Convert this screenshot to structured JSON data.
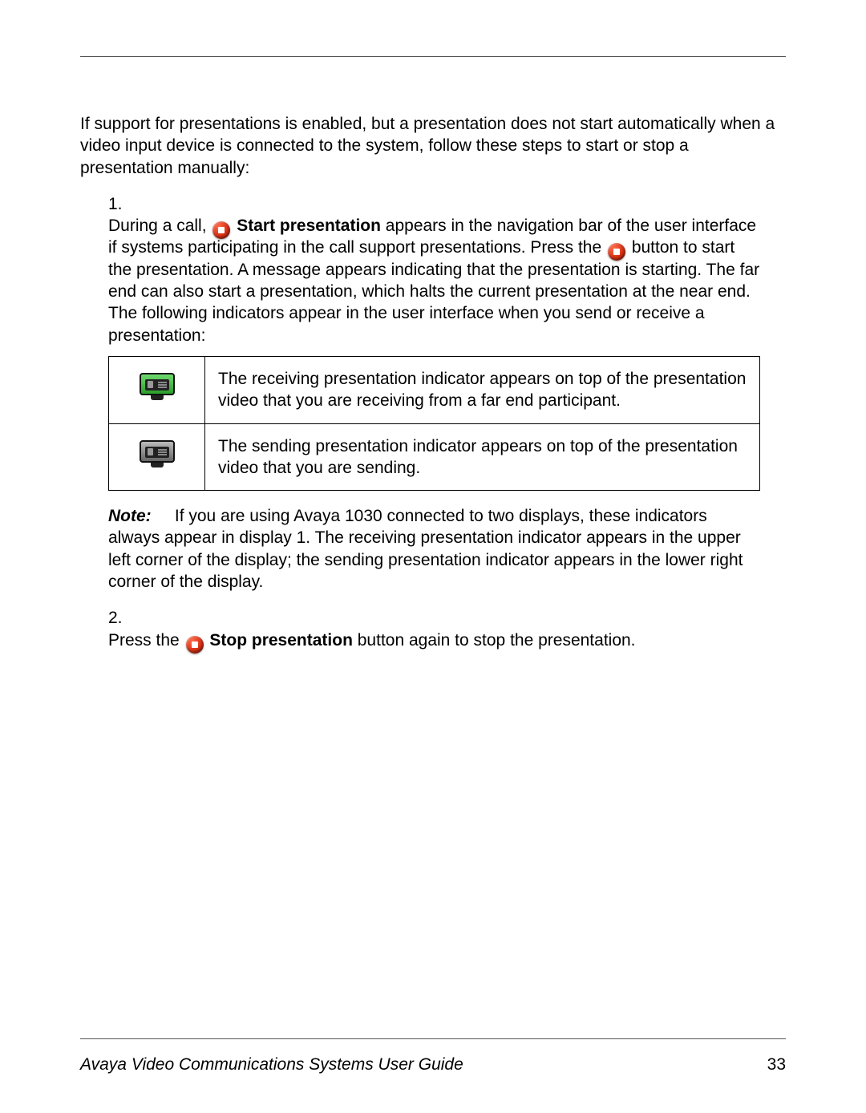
{
  "intro": "If support for presentations is enabled, but a presentation does not start automatically when a video input device is connected to the system, follow these steps to start or stop a presentation manually:",
  "step1": {
    "prefix": "During a call, ",
    "start_label": "Start presentation",
    "mid1": " appears in the navigation bar of the user interface if systems participating in the call support presentations. Press the ",
    "mid2": " button to start the presentation. A message appears indicating that the presentation is starting. The far end can also start a presentation, which halts the current presentation at the near end. The following indicators appear in the user interface when you send or receive a presentation:"
  },
  "table": {
    "row1": "The receiving presentation indicator appears on top of the presentation video that you are receiving from a far end participant.",
    "row2": "The sending presentation indicator appears on top of the presentation video that you are sending."
  },
  "note_label": "Note:",
  "note_body": "If you are using Avaya 1030 connected to two displays, these indicators always appear in display 1. The receiving presentation indicator appears in the upper left corner of the display; the sending presentation indicator appears in the lower right corner of the display.",
  "step2": {
    "prefix": "Press the ",
    "stop_label": "Stop presentation",
    "suffix": " button again to stop the presentation."
  },
  "footer": {
    "title": "Avaya Video Communications Systems User Guide",
    "page": "33"
  }
}
